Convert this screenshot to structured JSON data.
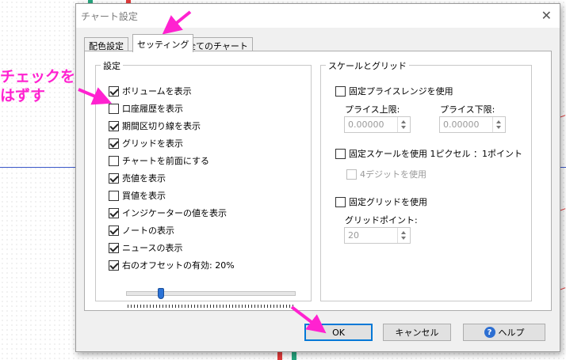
{
  "dialog": {
    "title": "チャート設定",
    "close_glyph": "✕"
  },
  "tabs": [
    {
      "label": "配色設定"
    },
    {
      "label": "セッティング"
    },
    {
      "label": "全てのチャート"
    }
  ],
  "settings": {
    "group_title": "設定",
    "checkboxes": [
      {
        "label": "ボリュームを表示",
        "checked": true
      },
      {
        "label": "口座履歴を表示",
        "checked": false
      },
      {
        "label": "期間区切り線を表示",
        "checked": true
      },
      {
        "label": "グリッドを表示",
        "checked": true
      },
      {
        "label": "チャートを前面にする",
        "checked": false
      },
      {
        "label": "売値を表示",
        "checked": true
      },
      {
        "label": "買値を表示",
        "checked": false
      },
      {
        "label": "インジケーターの値を表示",
        "checked": true
      },
      {
        "label": "ノートの表示",
        "checked": true
      },
      {
        "label": "ニュースの表示",
        "checked": true
      },
      {
        "label": "右のオフセットの有効: 20%",
        "checked": true
      }
    ],
    "offset_slider": 0.2
  },
  "scale": {
    "group_title": "スケールとグリッド",
    "fixed_range": {
      "label": "固定プライスレンジを使用",
      "checked": false
    },
    "upper_label": "プライス上限:",
    "upper_value": "0.00000",
    "lower_label": "プライス下限:",
    "lower_value": "0.00000",
    "fixed_scale": {
      "label": "固定スケールを使用 1ピクセル ：1ポイント",
      "checked": false
    },
    "four_digit": {
      "label": "4デジットを使用",
      "checked": false
    },
    "fixed_grid": {
      "label": "固定グリッドを使用",
      "checked": false
    },
    "grid_points_label": "グリッドポイント:",
    "grid_points_value": "20"
  },
  "buttons": {
    "ok": "OK",
    "cancel": "キャンセル",
    "help": "ヘルプ"
  },
  "annotation": {
    "line1": "チェックを",
    "line2": "はずす"
  },
  "colors": {
    "annotation": "#ff22d0",
    "accent": "#0078d7"
  }
}
